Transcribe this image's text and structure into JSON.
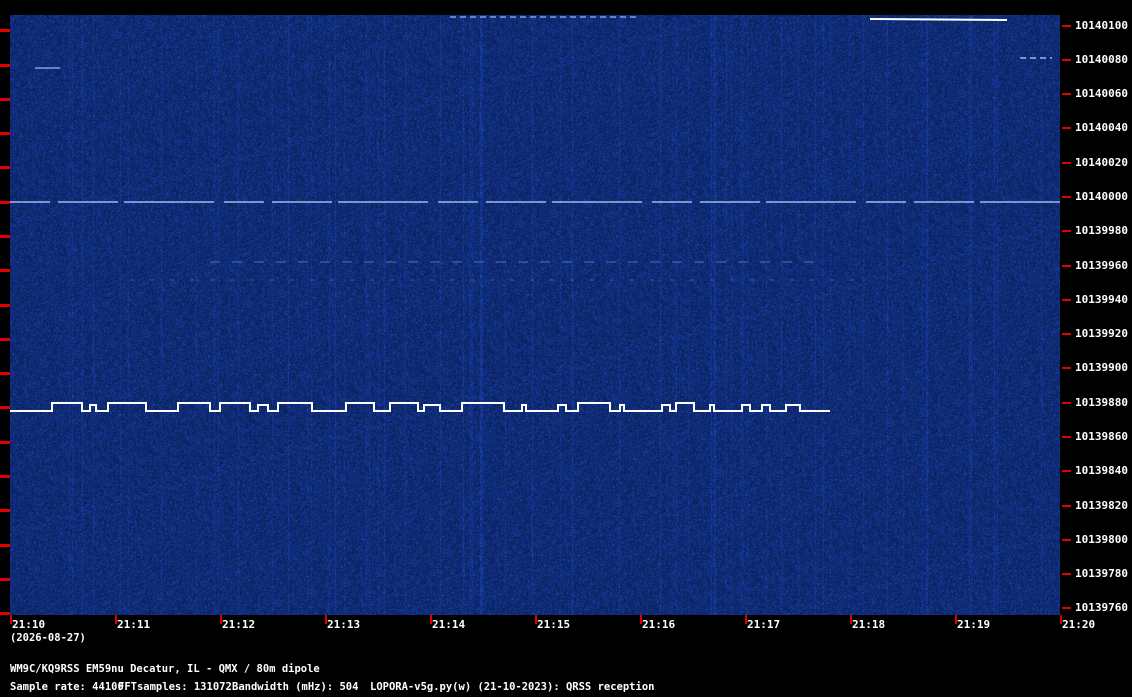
{
  "colors": {
    "background": "#0c2358",
    "signal": "#ffffff",
    "tick": "#e00000"
  },
  "frequency_labels": [
    "10140100",
    "10140080",
    "10140060",
    "10140040",
    "10140020",
    "10140000",
    "10139980",
    "10139960",
    "10139940",
    "10139920",
    "10139900",
    "10139880",
    "10139860",
    "10139840",
    "10139820",
    "10139800",
    "10139780",
    "10139760"
  ],
  "time_labels": [
    "21:10",
    "21:11",
    "21:12",
    "21:13",
    "21:14",
    "21:15",
    "21:16",
    "21:17",
    "21:18",
    "21:19",
    "21:20"
  ],
  "date": "(2026-08-27)",
  "station": "WM9C/KQ9RSS EM59nu Decatur, IL - QMX / 80m dipole",
  "sample_rate": "Sample rate: 44100",
  "fft_samples": "FFTsamples: 131072",
  "bandwidth": "Bandwidth (mHz): 504",
  "software": "LOPORA-v5g.py(w) (21-10-2023): QRSS reception"
}
